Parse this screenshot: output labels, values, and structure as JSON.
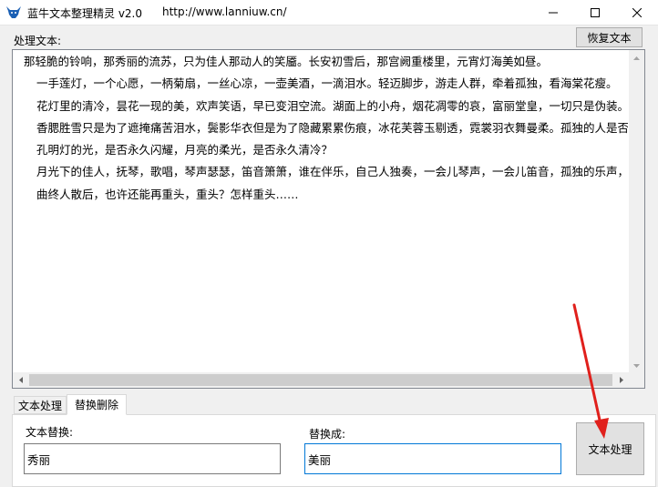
{
  "window": {
    "title": "蓝牛文本整理精灵 v2.0",
    "url": "http://www.lanniuw.cn/"
  },
  "editor": {
    "section_label": "处理文本:",
    "restore_button": "恢复文本",
    "lines": [
      "那轻脆的铃响，那秀丽的流苏，只为佳人那动人的笑靥。长安初雪后，那宫阙重楼里，元宵灯海美如昼。",
      "一手莲灯，一个心愿，一柄菊扇，一丝心凉，一壶美酒，一滴泪水。轻迈脚步，游走人群，牵着孤独，看海棠花瘦。",
      "花灯里的清冷，昙花一现的美，欢声笑语，早已变泪空流。湖面上的小舟，烟花凋零的哀，富丽堂皇，一切只是伪装。",
      "香腮胜雪只是为了遮掩痛苦泪水，鬓影华衣但是为了隐藏累累伤痕，冰花芙蓉玉剔透，霓裳羽衣舞曼柔。孤独的人是否会在",
      "孔明灯的光，是否永久闪耀，月亮的柔光，是否永久清冷？",
      "月光下的佳人，抚琴，歌唱，琴声瑟瑟，笛音箫箫，谁在伴乐，自己人独奏，一会儿琴声，一会儿笛音，孤独的乐声，幻想",
      "曲终人散后，也许还能再重头，重头？怎样重头……"
    ]
  },
  "tabs": [
    {
      "label": "文本处理"
    },
    {
      "label": "替换删除"
    }
  ],
  "replace": {
    "find_label": "文本替换:",
    "find_value": "秀丽",
    "replace_label": "替换成:",
    "replace_value": "美丽",
    "process_button": "文本处理"
  },
  "colors": {
    "arrow": "#e0201c",
    "focus_border": "#0078d7"
  }
}
